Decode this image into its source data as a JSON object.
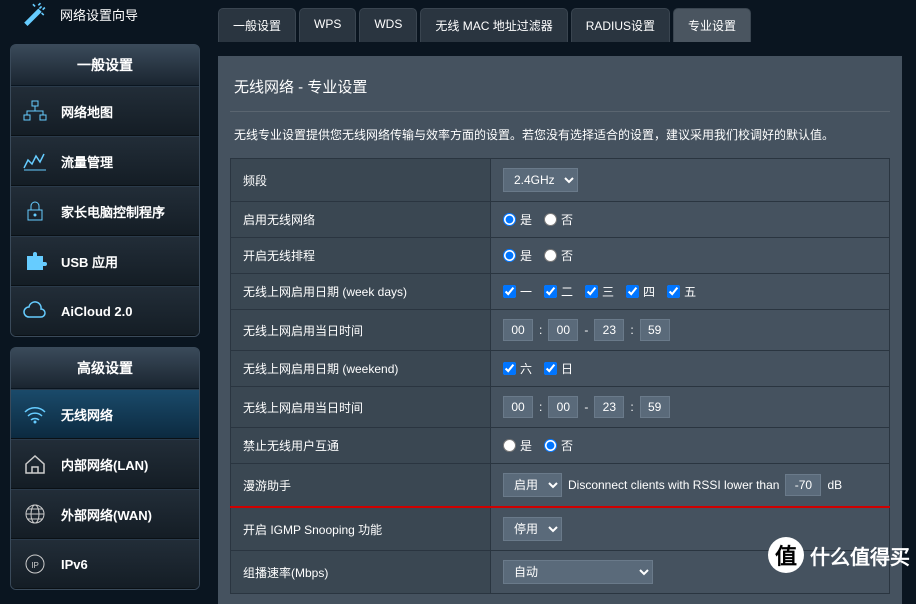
{
  "sidebar": {
    "top": {
      "label": "网络设置向导"
    },
    "section1": {
      "header": "一般设置",
      "items": [
        {
          "label": "网络地图"
        },
        {
          "label": "流量管理"
        },
        {
          "label": "家长电脑控制程序"
        },
        {
          "label": "USB 应用"
        },
        {
          "label": "AiCloud 2.0"
        }
      ]
    },
    "section2": {
      "header": "高级设置",
      "items": [
        {
          "label": "无线网络"
        },
        {
          "label": "内部网络(LAN)"
        },
        {
          "label": "外部网络(WAN)"
        },
        {
          "label": "IPv6"
        }
      ]
    }
  },
  "tabs": [
    "一般设置",
    "WPS",
    "WDS",
    "无线 MAC 地址过滤器",
    "RADIUS设置",
    "专业设置"
  ],
  "activeTab": "专业设置",
  "page": {
    "title": "无线网络 - 专业设置",
    "desc": "无线专业设置提供您无线网络传输与效率方面的设置。若您没有选择适合的设置，建议采用我们校调好的默认值。"
  },
  "form": {
    "band": {
      "label": "频段",
      "value": "2.4GHz"
    },
    "enableWireless": {
      "label": "启用无线网络",
      "yes": "是",
      "no": "否",
      "checked": "yes"
    },
    "enableSchedule": {
      "label": "开启无线排程",
      "yes": "是",
      "no": "否",
      "checked": "yes"
    },
    "weekdays": {
      "label": "无线上网启用日期 (week days)",
      "options": [
        "一",
        "二",
        "三",
        "四",
        "五"
      ]
    },
    "weekdayTime": {
      "label": "无线上网启用当日时间",
      "h1": "00",
      "m1": "00",
      "h2": "23",
      "m2": "59"
    },
    "weekend": {
      "label": "无线上网启用日期 (weekend)",
      "options": [
        "六",
        "日"
      ]
    },
    "weekendTime": {
      "label": "无线上网启用当日时间",
      "h1": "00",
      "m1": "00",
      "h2": "23",
      "m2": "59"
    },
    "isolate": {
      "label": "禁止无线用户互通",
      "yes": "是",
      "no": "否",
      "checked": "no"
    },
    "roaming": {
      "label": "漫游助手",
      "value": "启用",
      "desc": "Disconnect clients with RSSI lower than",
      "rssi": "-70",
      "unit": "dB"
    },
    "igmp": {
      "label": "开启 IGMP Snooping 功能",
      "value": "停用"
    },
    "mcast": {
      "label": "组播速率(Mbps)",
      "value": "自动"
    }
  },
  "watermark": "什么值得买"
}
